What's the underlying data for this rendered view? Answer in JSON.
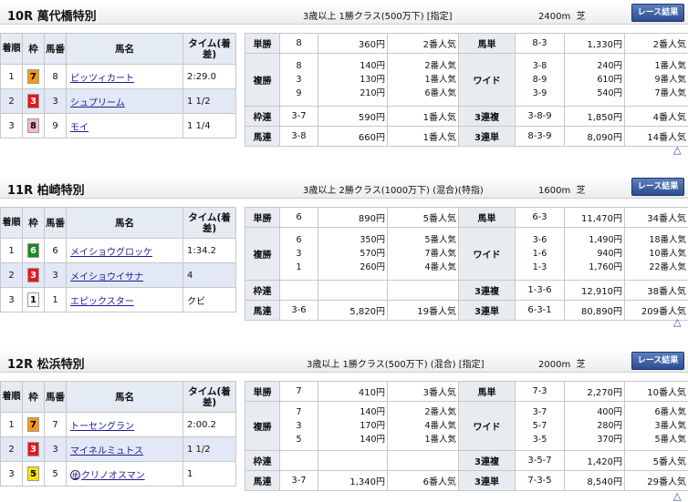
{
  "gate_colors": {
    "1": {
      "bg": "#ffffff",
      "fg": "#000000"
    },
    "3": {
      "bg": "#e8161b",
      "fg": "#ffffff"
    },
    "5": {
      "bg": "#f5e400",
      "fg": "#000000"
    },
    "6": {
      "bg": "#1a8a1e",
      "fg": "#ffffff"
    },
    "7": {
      "bg": "#f59a18",
      "fg": "#000000"
    },
    "8": {
      "bg": "#f7b9c8",
      "fg": "#000000"
    }
  },
  "result_headers": {
    "chaku": "着順",
    "waku": "枠",
    "uma": "馬番",
    "name": "馬名",
    "time": "タイム(着差)"
  },
  "results_button": "レース結果",
  "top_icon": "△",
  "bet_labels": {
    "win": "単勝",
    "place": "複勝",
    "bracket": "枠連",
    "quinella": "馬連",
    "exacta": "馬単",
    "wide": "ワイド",
    "trio": "3連複",
    "trifecta": "3連単"
  },
  "races": [
    {
      "no": "10R",
      "name": "萬代橋特別",
      "condition": "3歳以上 1勝クラス(500万下) [指定]",
      "distance": "2400m",
      "surface": "芝",
      "horses": [
        {
          "rank": "1",
          "waku": "7",
          "uma": "8",
          "name": "ピッツィカート",
          "time": "2:29.0",
          "mark": ""
        },
        {
          "rank": "2",
          "waku": "3",
          "uma": "3",
          "name": "シュプリーム",
          "time": "1 1/2",
          "mark": ""
        },
        {
          "rank": "3",
          "waku": "8",
          "uma": "9",
          "name": "モイ",
          "time": "1 1/4",
          "mark": ""
        }
      ],
      "payouts": {
        "win": {
          "combo": "8",
          "pay": "360円",
          "pop": "2番人気"
        },
        "place": {
          "combos": "8\n3\n9",
          "pays": "140円\n130円\n210円",
          "pops": "2番人気\n1番人気\n6番人気"
        },
        "bracket": {
          "combo": "3-7",
          "pay": "590円",
          "pop": "1番人気"
        },
        "quinella": {
          "combo": "3-8",
          "pay": "660円",
          "pop": "1番人気"
        },
        "exacta": {
          "combo": "8-3",
          "pay": "1,330円",
          "pop": "2番人気"
        },
        "wide": {
          "combos": "3-8\n8-9\n3-9",
          "pays": "240円\n610円\n540円",
          "pops": "1番人気\n9番人気\n7番人気"
        },
        "trio": {
          "combo": "3-8-9",
          "pay": "1,850円",
          "pop": "4番人気"
        },
        "trifecta": {
          "combo": "8-3-9",
          "pay": "8,090円",
          "pop": "14番人気"
        }
      }
    },
    {
      "no": "11R",
      "name": "柏崎特別",
      "condition": "3歳以上 2勝クラス(1000万下) (混合)(特指)",
      "distance": "1600m",
      "surface": "芝",
      "horses": [
        {
          "rank": "1",
          "waku": "6",
          "uma": "6",
          "name": "メイショウグロッケ",
          "time": "1:34.2",
          "mark": ""
        },
        {
          "rank": "2",
          "waku": "3",
          "uma": "3",
          "name": "メイショウイサナ",
          "time": "4",
          "mark": ""
        },
        {
          "rank": "3",
          "waku": "1",
          "uma": "1",
          "name": "エピックスター",
          "time": "クビ",
          "mark": ""
        }
      ],
      "payouts": {
        "win": {
          "combo": "6",
          "pay": "890円",
          "pop": "5番人気"
        },
        "place": {
          "combos": "6\n3\n1",
          "pays": "350円\n570円\n260円",
          "pops": "5番人気\n7番人気\n4番人気"
        },
        "bracket": {
          "combo": "",
          "pay": "",
          "pop": ""
        },
        "quinella": {
          "combo": "3-6",
          "pay": "5,820円",
          "pop": "19番人気"
        },
        "exacta": {
          "combo": "6-3",
          "pay": "11,470円",
          "pop": "34番人気"
        },
        "wide": {
          "combos": "3-6\n1-6\n1-3",
          "pays": "1,490円\n940円\n1,760円",
          "pops": "18番人気\n10番人気\n22番人気"
        },
        "trio": {
          "combo": "1-3-6",
          "pay": "12,910円",
          "pop": "38番人気"
        },
        "trifecta": {
          "combo": "6-3-1",
          "pay": "80,890円",
          "pop": "209番人気"
        }
      }
    },
    {
      "no": "12R",
      "name": "松浜特別",
      "condition": "3歳以上 1勝クラス(500万下) (混合) [指定]",
      "distance": "2000m",
      "surface": "芝",
      "horses": [
        {
          "rank": "1",
          "waku": "7",
          "uma": "7",
          "name": "トーセングラン",
          "time": "2:00.2",
          "mark": ""
        },
        {
          "rank": "2",
          "waku": "3",
          "uma": "3",
          "name": "マイネルミュトス",
          "time": "1 1/2",
          "mark": ""
        },
        {
          "rank": "3",
          "waku": "5",
          "uma": "5",
          "name": "クリノオスマン",
          "time": "1",
          "mark": "地"
        }
      ],
      "payouts": {
        "win": {
          "combo": "7",
          "pay": "410円",
          "pop": "3番人気"
        },
        "place": {
          "combos": "7\n3\n5",
          "pays": "140円\n170円\n140円",
          "pops": "2番人気\n4番人気\n1番人気"
        },
        "bracket": {
          "combo": "",
          "pay": "",
          "pop": ""
        },
        "quinella": {
          "combo": "3-7",
          "pay": "1,340円",
          "pop": "6番人気"
        },
        "exacta": {
          "combo": "7-3",
          "pay": "2,270円",
          "pop": "10番人気"
        },
        "wide": {
          "combos": "3-7\n5-7\n3-5",
          "pays": "400円\n280円\n370円",
          "pops": "6番人気\n3番人気\n5番人気"
        },
        "trio": {
          "combo": "3-5-7",
          "pay": "1,420円",
          "pop": "5番人気"
        },
        "trifecta": {
          "combo": "7-3-5",
          "pay": "8,540円",
          "pop": "29番人気"
        }
      }
    }
  ]
}
